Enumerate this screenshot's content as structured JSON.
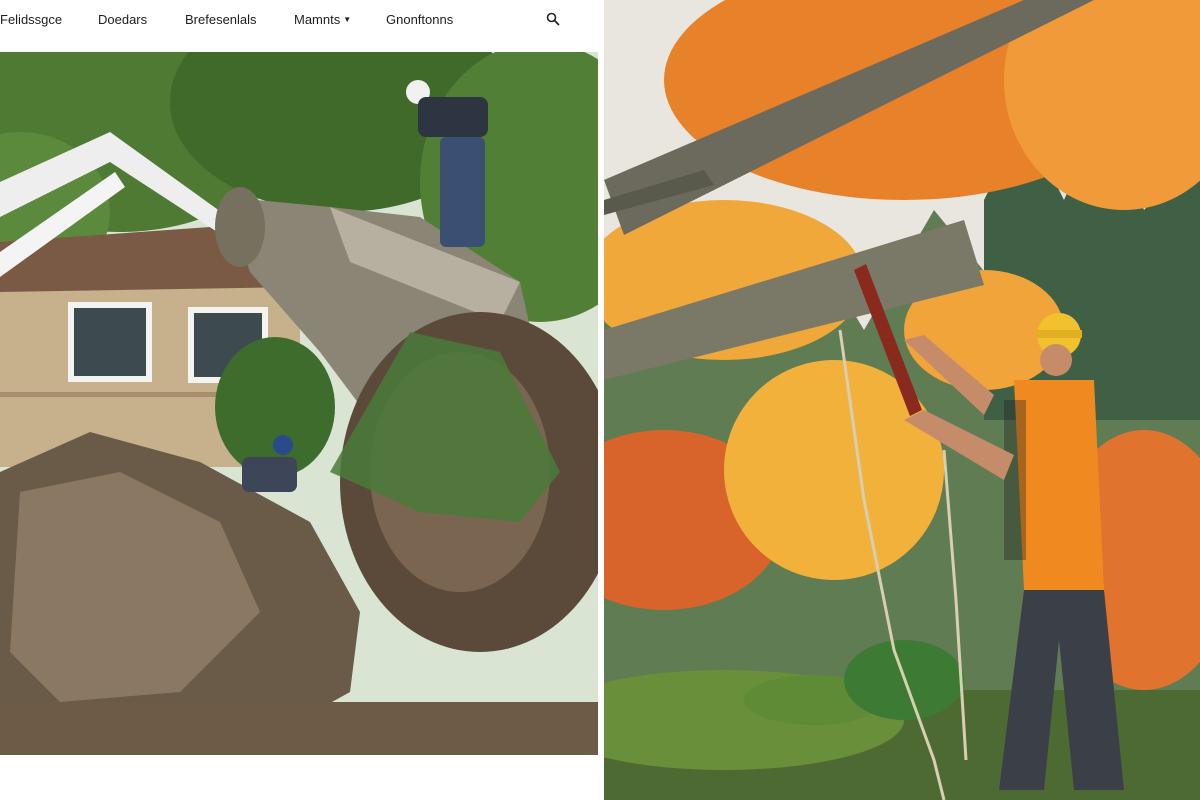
{
  "nav": {
    "brand": "Felidssgce",
    "items": [
      {
        "label": "Doedars"
      },
      {
        "label": "Brefesenlals"
      },
      {
        "label": "Mamnts"
      },
      {
        "label": "Gnonftonns"
      }
    ],
    "search_icon": "search-icon",
    "dropdown_icon": "chevron-down-icon"
  },
  "images": [
    {
      "name": "storm-damage-photo"
    },
    {
      "name": "arborist-pruning-photo"
    }
  ],
  "colors": {
    "nav_text": "#1e1e1e",
    "background": "#ffffff",
    "autumn_orange": "#e8822a",
    "arborist_helmet": "#f2c12e"
  }
}
